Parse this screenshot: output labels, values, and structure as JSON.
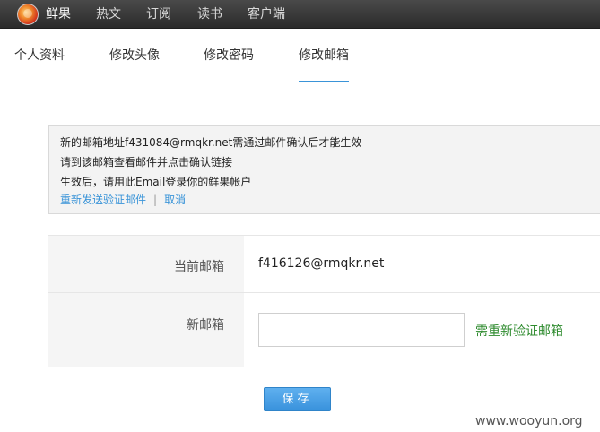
{
  "topbar": {
    "logo_icon": "xianguo-logo-icon",
    "nav": [
      "鲜果",
      "热文",
      "订阅",
      "读书",
      "客户端"
    ]
  },
  "tabs": [
    "个人资料",
    "修改头像",
    "修改密码",
    "修改邮箱"
  ],
  "active_tab": "修改邮箱",
  "notice": {
    "line1": "新的邮箱地址f431084@rmqkr.net需通过邮件确认后才能生效",
    "line2": "请到该邮箱查看邮件并点击确认链接",
    "line3": "生效后，请用此Email登录你的鲜果帐户",
    "resend_link": "重新发送验证邮件",
    "separator": "|",
    "cancel_link": "取消"
  },
  "form": {
    "current_label": "当前邮箱",
    "current_value": "f416126@rmqkr.net",
    "new_label": "新邮箱",
    "new_value": "",
    "hint": "需重新验证邮箱"
  },
  "save_label": "保存",
  "watermark": "www.wooyun.org",
  "colors": {
    "accent": "#3a94d8",
    "hint_green": "#2e8b2e",
    "topbar": "#333333"
  }
}
